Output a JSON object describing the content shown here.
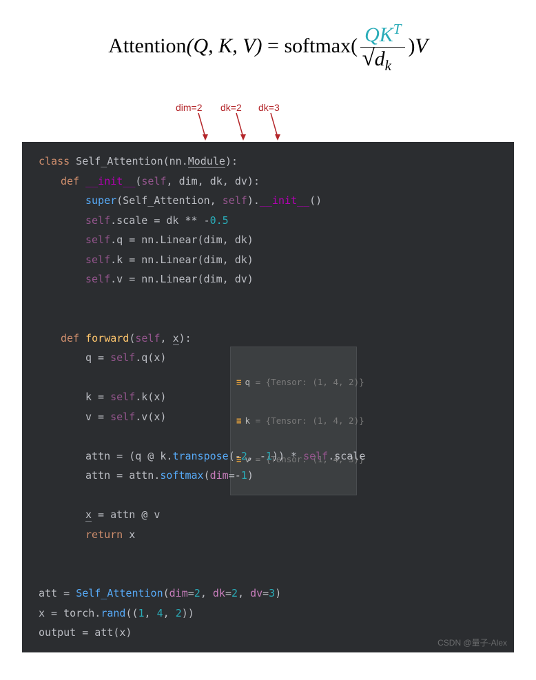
{
  "formula": {
    "lhs_fn": "Attention",
    "lhs_args": "(Q, K, V)",
    "eq": " = ",
    "rhs_fn": "softmax",
    "frac_num_Q": "Q",
    "frac_num_K": "K",
    "frac_num_sup": "T",
    "frac_den_d": "d",
    "frac_den_sub": "k",
    "tail": "V"
  },
  "annotations": {
    "a1": "dim=2",
    "a2": "dk=2",
    "a3": "dk=3"
  },
  "code": {
    "l01_kw_class": "class",
    "l01_cls": " Self_Attention",
    "l01_paren": "(nn.",
    "l01_mod": "Module",
    "l01_close": "):",
    "l02_kw_def": "def",
    "l02_fn": " __init__",
    "l02_args_open": "(",
    "l02_self": "self",
    "l02_args": ", dim, dk, dv):",
    "l03_super": "super",
    "l03_args1": "(Self_Attention, ",
    "l03_self": "self",
    "l03_args2": ").",
    "l03_init": "__init__",
    "l03_close": "()",
    "l04_self": "self",
    "l04_rest1": ".scale = dk ** -",
    "l04_num": "0.5",
    "l05_self": "self",
    "l05_rest": ".q = nn.Linear(dim, dk)",
    "l06_self": "self",
    "l06_rest": ".k = nn.Linear(dim, dk)",
    "l07_self": "self",
    "l07_rest": ".v = nn.Linear(dim, dv)",
    "l09_kw_def": "def",
    "l09_fn": " forward",
    "l09_open": "(",
    "l09_self": "self",
    "l09_args": ", ",
    "l09_x": "x",
    "l09_close": "):",
    "l10_q": "q = ",
    "l10_self": "self",
    "l10_rest": ".q(x)",
    "l11_k": "k = ",
    "l11_self": "self",
    "l11_rest": ".k(x)",
    "l12_v": "v = ",
    "l12_self": "self",
    "l12_rest": ".v(x)",
    "l14_a": "attn = (q @ k.",
    "l14_fn": "transpose",
    "l14_args": "(-",
    "l14_n1": "2",
    "l14_mid": ", -",
    "l14_n2": "1",
    "l14_close": ")) * ",
    "l14_self": "self",
    "l14_rest": ".scale",
    "l15_a": "attn = attn.",
    "l15_fn": "softmax",
    "l15_args": "(",
    "l15_dim": "dim",
    "l15_eq": "=-",
    "l15_n": "1",
    "l15_close": ")",
    "l17_x": "x",
    "l17_rest": " = attn @ v",
    "l18_ret": "return",
    "l18_x": " x",
    "l20_att": "att = ",
    "l20_cls": "Self_Attention",
    "l20_args": "(",
    "l20_p1": "dim",
    "l20_e": "=",
    "l20_v1": "2",
    "l20_c1": ", ",
    "l20_p2": "dk",
    "l20_v2": "2",
    "l20_c2": ", ",
    "l20_p3": "dv",
    "l20_v3": "3",
    "l20_close": ")",
    "l21_x": "x = torch.",
    "l21_fn": "rand",
    "l21_args": "((",
    "l21_n1": "1",
    "l21_n2": "4",
    "l21_n3": "2",
    "l21_close": "))",
    "l22": "output = att(x)"
  },
  "tooltip": {
    "q_var": "q",
    "q_val": " = {Tensor: (1, 4, 2)}",
    "k_var": "k",
    "k_val": " = {Tensor: (1, 4, 2)}",
    "v_var": "v",
    "v_val": " = {Tensor: (1, 4, 3)}"
  },
  "watermark": "CSDN @量子-Alex"
}
